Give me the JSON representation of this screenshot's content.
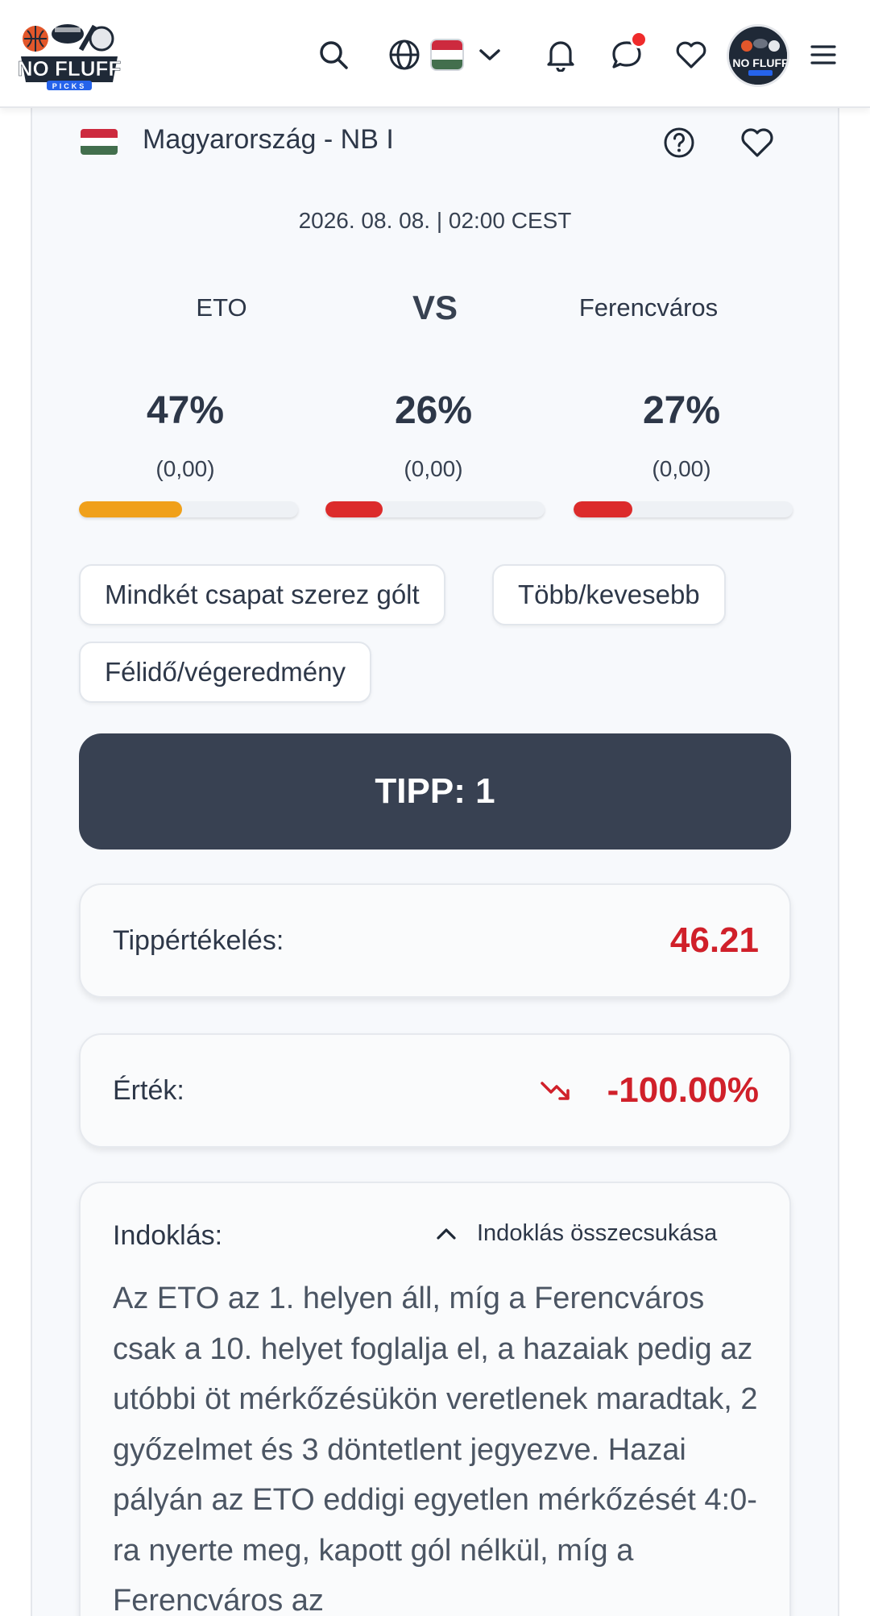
{
  "header": {
    "logo_text": "NO FLUFF",
    "logo_subtext": "PICKS",
    "language_flag": "HU",
    "notification_dot_color": "#ef2b2b"
  },
  "match": {
    "league": "Magyarország - NB I",
    "date": "2026. 08. 08. | 02:00 CEST",
    "home_team": "ETO",
    "vs": "VS",
    "away_team": "Ferencváros",
    "outcomes": [
      {
        "percent": "47%",
        "odds": "(0,00)",
        "fill": 0.47,
        "color": "#f0a01a"
      },
      {
        "percent": "26%",
        "odds": "(0,00)",
        "fill": 0.26,
        "color": "#dc2b2b"
      },
      {
        "percent": "27%",
        "odds": "(0,00)",
        "fill": 0.27,
        "color": "#dc2b2b"
      }
    ]
  },
  "markets": [
    "Mindkét csapat szerez gólt",
    "Több/kevesebb",
    "Félidő/végeredmény"
  ],
  "tip": {
    "label": "TIPP: 1"
  },
  "rating": {
    "label": "Tippértékelés:",
    "value": "46.21"
  },
  "value": {
    "label": "Érték:",
    "value": "-100.00%",
    "trend": "down"
  },
  "reason": {
    "label": "Indoklás:",
    "collapse_label": "Indoklás összecsukása",
    "text": "Az ETO az 1. helyen áll, míg a Ferencváros csak a 10. helyet foglalja el, a hazaiak pedig az utóbbi öt mérkőzésükön veretlenek maradtak, 2 győzelmet és 3 döntetlent jegyezve. Hazai pályán az ETO eddigi egyetlen mérkőzését 4:0-ra nyerte meg, kapott gól nélkül, míg a Ferencváros az"
  },
  "colors": {
    "accent_dark": "#384152",
    "negative": "#d0202a",
    "home_bar": "#f0a01a",
    "other_bar": "#dc2b2b"
  }
}
